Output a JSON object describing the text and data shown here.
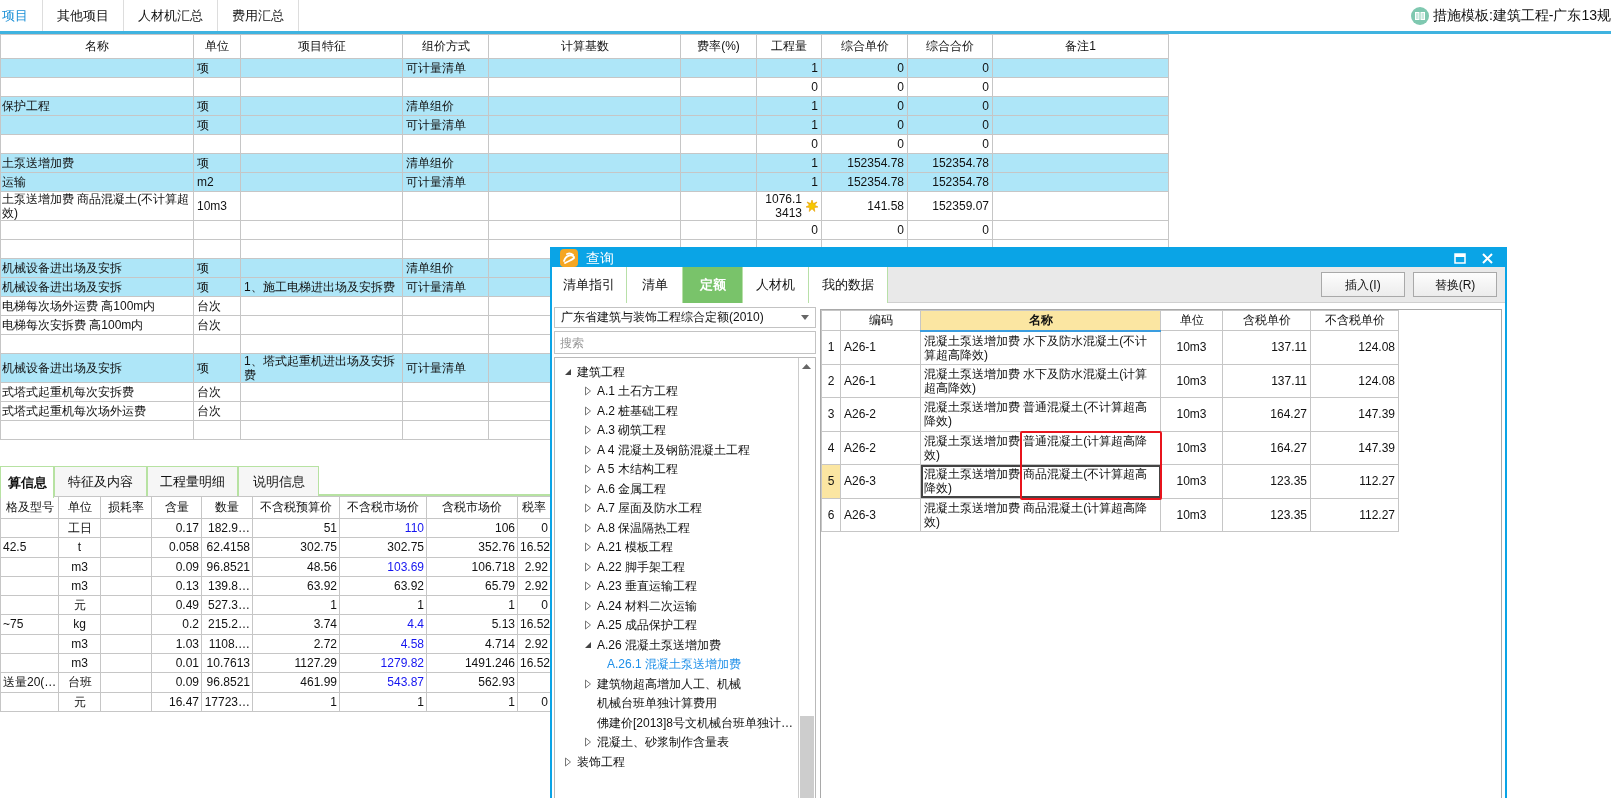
{
  "top_tabs": [
    {
      "label": "项目",
      "selected": true
    },
    {
      "label": "其他项目",
      "selected": false
    },
    {
      "label": "人材机汇总",
      "selected": false
    },
    {
      "label": "费用汇总",
      "selected": false
    }
  ],
  "template_label": "措施模板:建筑工程-广东13规",
  "main_table": {
    "columns": [
      "名称",
      "单位",
      "项目特征",
      "组价方式",
      "计算基数",
      "费率(%)",
      "工程量",
      "综合单价",
      "综合合价",
      "备注1"
    ],
    "rows": [
      {
        "highlighted": true,
        "starred": false,
        "unit": "项",
        "pricing_method": "可计量清单",
        "quantity": "1",
        "unit_price": "0",
        "total_price": "0"
      },
      {
        "highlighted": false,
        "starred": false,
        "quantity": "0",
        "unit_price": "0",
        "total_price": "0"
      },
      {
        "highlighted": true,
        "starred": false,
        "name": "保护工程",
        "unit": "项",
        "pricing_method": "清单组价",
        "quantity": "1",
        "unit_price": "0",
        "total_price": "0"
      },
      {
        "highlighted": true,
        "starred": false,
        "unit": "项",
        "pricing_method": "可计量清单",
        "quantity": "1",
        "unit_price": "0",
        "total_price": "0"
      },
      {
        "highlighted": false,
        "starred": false,
        "quantity": "0",
        "unit_price": "0",
        "total_price": "0"
      },
      {
        "highlighted": true,
        "starred": false,
        "name": "土泵送增加费",
        "unit": "项",
        "pricing_method": "清单组价",
        "quantity": "1",
        "unit_price": "152354.78",
        "total_price": "152354.78"
      },
      {
        "highlighted": true,
        "starred": false,
        "name": "运输",
        "unit": "m2",
        "pricing_method": "可计量清单",
        "quantity": "1",
        "unit_price": "152354.78",
        "total_price": "152354.78"
      },
      {
        "highlighted": false,
        "starred": true,
        "name": "土泵送增加费 商品混凝土(不计算超效)",
        "unit": "10m3",
        "quantity": "1076.13413",
        "unit_price": "141.58",
        "total_price": "152359.07"
      },
      {
        "highlighted": false,
        "starred": false,
        "quantity": "0",
        "unit_price": "0",
        "total_price": "0"
      },
      {
        "highlighted": false,
        "starred": false
      },
      {
        "highlighted": true,
        "starred": false,
        "name": "机械设备进出场及安拆",
        "unit": "项",
        "pricing_method": "清单组价"
      },
      {
        "highlighted": true,
        "starred": false,
        "name": "机械设备进出场及安拆",
        "unit": "项",
        "features": "1、施工电梯进出场及安拆费",
        "pricing_method": "可计量清单"
      },
      {
        "highlighted": false,
        "starred": false,
        "name": "电梯每次场外运费 高100m内",
        "unit": "台次"
      },
      {
        "highlighted": false,
        "starred": false,
        "name": "电梯每次安拆费 高100m内",
        "unit": "台次"
      },
      {
        "highlighted": false,
        "starred": false
      },
      {
        "highlighted": true,
        "starred": false,
        "name": "机械设备进出场及安拆",
        "unit": "项",
        "features": "1、塔式起重机进出场及安拆费",
        "pricing_method": "可计量清单"
      },
      {
        "highlighted": false,
        "starred": false,
        "name": "式塔式起重机每次安拆费",
        "unit": "台次"
      },
      {
        "highlighted": false,
        "starred": false,
        "name": "式塔式起重机每次场外运费",
        "unit": "台次"
      },
      {
        "highlighted": false,
        "starred": false
      }
    ]
  },
  "detail_tabs": [
    {
      "label": "算信息",
      "selected": true
    },
    {
      "label": "特征及内容",
      "selected": false
    },
    {
      "label": "工程量明细",
      "selected": false
    },
    {
      "label": "说明信息",
      "selected": false
    }
  ],
  "resource_table": {
    "columns": [
      "格及型号",
      "单位",
      "损耗率",
      "含量",
      "数量",
      "不含税预算价",
      "不含税市场价",
      "含税市场价",
      "税率"
    ],
    "rows": [
      {
        "price_changed": true,
        "unit": "工日",
        "content": "0.17",
        "quantity": "182.9…",
        "budget_price": "51",
        "market_price": "110",
        "market_price_tax": "106",
        "tax_rate": "0"
      },
      {
        "price_changed": false,
        "spec": "42.5",
        "unit": "t",
        "content": "0.058",
        "quantity": "62.4158",
        "budget_price": "302.75",
        "market_price": "302.75",
        "market_price_tax": "352.76",
        "tax_rate": "16.52"
      },
      {
        "price_changed": true,
        "unit": "m3",
        "content": "0.09",
        "quantity": "96.8521",
        "budget_price": "48.56",
        "market_price": "103.69",
        "market_price_tax": "106.718",
        "tax_rate": "2.92"
      },
      {
        "price_changed": false,
        "unit": "m3",
        "content": "0.13",
        "quantity": "139.8…",
        "budget_price": "63.92",
        "market_price": "63.92",
        "market_price_tax": "65.79",
        "tax_rate": "2.92"
      },
      {
        "price_changed": false,
        "unit": "元",
        "content": "0.49",
        "quantity": "527.3…",
        "budget_price": "1",
        "market_price": "1",
        "market_price_tax": "1",
        "tax_rate": "0"
      },
      {
        "price_changed": true,
        "spec": "~75",
        "unit": "kg",
        "content": "0.2",
        "quantity": "215.2…",
        "budget_price": "3.74",
        "market_price": "4.4",
        "market_price_tax": "5.13",
        "tax_rate": "16.52"
      },
      {
        "price_changed": true,
        "unit": "m3",
        "content": "1.03",
        "quantity": "1108.…",
        "budget_price": "2.72",
        "market_price": "4.58",
        "market_price_tax": "4.714",
        "tax_rate": "2.92"
      },
      {
        "price_changed": true,
        "unit": "m3",
        "content": "0.01",
        "quantity": "10.7613",
        "budget_price": "1127.29",
        "market_price": "1279.82",
        "market_price_tax": "1491.246",
        "tax_rate": "16.52"
      },
      {
        "price_changed": true,
        "spec": "送量20(…",
        "unit": "台班",
        "content": "0.09",
        "quantity": "96.8521",
        "budget_price": "461.99",
        "market_price": "543.87",
        "market_price_tax": "562.93"
      },
      {
        "price_changed": false,
        "unit": "元",
        "content": "16.47",
        "quantity": "17723…",
        "budget_price": "1",
        "market_price": "1",
        "market_price_tax": "1",
        "tax_rate": "0"
      }
    ]
  },
  "dialog": {
    "title": "查询",
    "tabs": [
      {
        "label": "清单指引",
        "selected": false
      },
      {
        "label": "清单",
        "selected": false
      },
      {
        "label": "定额",
        "selected": true
      },
      {
        "label": "人材机",
        "selected": false
      },
      {
        "label": "我的数据",
        "selected": false
      }
    ],
    "buttons": [
      "插入(I)",
      "替换(R)"
    ],
    "library": "广东省建筑与装饰工程综合定额(2010)",
    "search": {
      "placeholder": "搜索"
    },
    "tree": [
      {
        "label": "建筑工程",
        "kind": "folder",
        "expanded": true,
        "selected": false,
        "children": [
          {
            "label": "A.1  土石方工程",
            "kind": "folder",
            "expanded": false,
            "selected": false
          },
          {
            "label": "A.2  桩基础工程",
            "kind": "folder",
            "expanded": false,
            "selected": false
          },
          {
            "label": "A.3  砌筑工程",
            "kind": "folder",
            "expanded": false,
            "selected": false
          },
          {
            "label": "A 4  混凝土及钢筋混凝土工程",
            "kind": "folder",
            "expanded": false,
            "selected": false
          },
          {
            "label": "A 5  木结构工程",
            "kind": "folder",
            "expanded": false,
            "selected": false
          },
          {
            "label": "A.6  金属工程",
            "kind": "folder",
            "expanded": false,
            "selected": false
          },
          {
            "label": "A.7  屋面及防水工程",
            "kind": "folder",
            "expanded": false,
            "selected": false
          },
          {
            "label": "A.8  保温隔热工程",
            "kind": "folder",
            "expanded": false,
            "selected": false
          },
          {
            "label": "A.21  模板工程",
            "kind": "folder",
            "expanded": false,
            "selected": false
          },
          {
            "label": "A.22  脚手架工程",
            "kind": "folder",
            "expanded": false,
            "selected": false
          },
          {
            "label": "A.23  垂直运输工程",
            "kind": "folder",
            "expanded": false,
            "selected": false
          },
          {
            "label": "A.24  材料二次运输",
            "kind": "folder",
            "expanded": false,
            "selected": false
          },
          {
            "label": "A.25  成品保护工程",
            "kind": "folder",
            "expanded": false,
            "selected": false
          },
          {
            "label": "A.26  混凝土泵送增加费",
            "kind": "folder",
            "expanded": true,
            "selected": false,
            "children": [
              {
                "label": "A.26.1  混凝土泵送增加费",
                "kind": "leaf",
                "selected": true
              }
            ]
          },
          {
            "label": "建筑物超高增加人工、机械",
            "kind": "folder",
            "expanded": false,
            "selected": false
          },
          {
            "label": "机械台班单独计算费用",
            "kind": "leaf",
            "selected": false
          },
          {
            "label": "佛建价[2013]8号文机械台班单独计…",
            "kind": "leaf",
            "selected": false
          },
          {
            "label": "混凝土、砂浆制作含量表",
            "kind": "folder",
            "expanded": false,
            "selected": false
          }
        ]
      },
      {
        "label": "装饰工程",
        "kind": "folder",
        "expanded": false,
        "selected": false
      }
    ],
    "quota_table": {
      "columns": [
        {
          "label": "编码",
          "selected": false
        },
        {
          "label": "名称",
          "selected": true
        },
        {
          "label": "单位",
          "selected": false
        },
        {
          "label": "含税单价",
          "selected": false
        },
        {
          "label": "不含税单价",
          "selected": false
        }
      ],
      "rows": [
        {
          "number": "1",
          "code": "A26-1",
          "name": "混凝土泵送增加费 水下及防水混凝土(不计算超高降效)",
          "unit": "10m3",
          "price_tax": "137.11",
          "price": "124.08",
          "selected": false,
          "annotated": false
        },
        {
          "number": "2",
          "code": "A26-1",
          "name": "混凝土泵送增加费 水下及防水混凝土(计算超高降效)",
          "unit": "10m3",
          "price_tax": "137.11",
          "price": "124.08",
          "selected": false,
          "annotated": false
        },
        {
          "number": "3",
          "code": "A26-2",
          "name": "混凝土泵送增加费 普通混凝土(不计算超高降效)",
          "unit": "10m3",
          "price_tax": "164.27",
          "price": "147.39",
          "selected": false,
          "annotated": false
        },
        {
          "number": "4",
          "code": "A26-2",
          "name": "混凝土泵送增加费 普通混凝土(计算超高降效)",
          "unit": "10m3",
          "price_tax": "164.27",
          "price": "147.39",
          "selected": false,
          "annotated": true
        },
        {
          "number": "5",
          "code": "A26-3",
          "name": "混凝土泵送增加费 商品混凝土(不计算超高降效)",
          "unit": "10m3",
          "price_tax": "123.35",
          "price": "112.27",
          "selected": true,
          "annotated": true
        },
        {
          "number": "6",
          "code": "A26-3",
          "name": "混凝土泵送增加费 商品混凝土(计算超高降效)",
          "unit": "10m3",
          "price_tax": "123.35",
          "price": "112.27",
          "selected": false,
          "annotated": false
        }
      ]
    }
  }
}
